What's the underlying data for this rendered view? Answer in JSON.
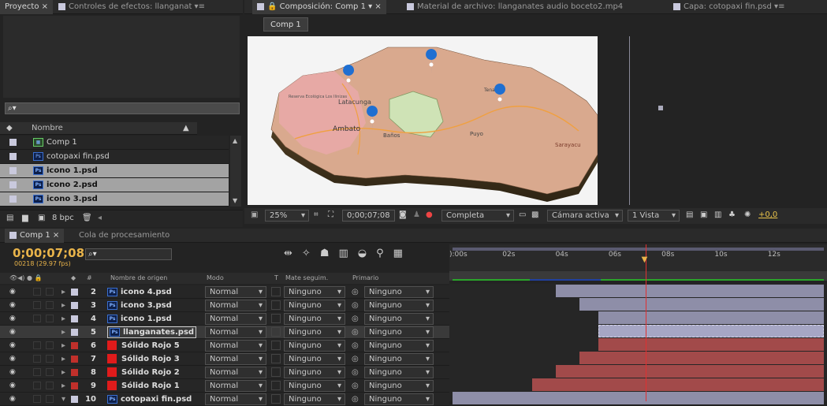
{
  "project_panel": {
    "tabs": [
      "Proyecto",
      "Controles de efectos: llanganat"
    ],
    "search_placeholder": "⌕▾",
    "column": "Nombre",
    "items": [
      {
        "name": "Comp 1",
        "type": "comp",
        "color": "#c9c9dd"
      },
      {
        "name": "cotopaxi fin.psd",
        "type": "psd",
        "color": "#c9c9dd"
      },
      {
        "name": "icono 1.psd",
        "type": "psd",
        "color": "#c9c9dd"
      },
      {
        "name": "icono 2.psd",
        "type": "psd",
        "color": "#c9c9dd"
      },
      {
        "name": "icono 3.psd",
        "type": "psd",
        "color": "#c9c9dd"
      }
    ],
    "bpc": "8 bpc"
  },
  "comp_panel": {
    "tabs": [
      "Composición: Comp 1",
      "Material de archivo: llanganates audio boceto2.mp4",
      "Capa: cotopaxi fin.psd"
    ],
    "subtab": "Comp 1",
    "viewer": {
      "zoom": "25%",
      "timecode": "0;00;07;08",
      "resolution": "Completa",
      "camera": "Cámara activa",
      "views": "1 Vista",
      "exposure": "+0,0"
    },
    "map_labels": [
      "Latacunga",
      "Ambato",
      "Baños",
      "Puyo",
      "Sarayacu",
      "Tena",
      "Reserva Ecológica Los Ilinizas"
    ]
  },
  "timeline": {
    "tabs": [
      "Comp 1",
      "Cola de procesamiento"
    ],
    "timecode": "0;00;07;08",
    "frames": "00218 (29.97 fps)",
    "headers": {
      "source": "Nombre de origen",
      "mode": "Modo",
      "t": "T",
      "matte": "Mate seguim.",
      "parent": "Primario"
    },
    "ruler": [
      "):00s",
      "02s",
      "04s",
      "06s",
      "08s",
      "10s",
      "12s"
    ],
    "layers": [
      {
        "num": "2",
        "name": "icono 4.psd",
        "kind": "psd",
        "label": "#c9c9dd",
        "mode": "Normal",
        "matte": "Ninguno",
        "parent": "Ninguno",
        "start": 3.9,
        "end": 14,
        "bar": "#8e8ea8"
      },
      {
        "num": "3",
        "name": "icono 3.psd",
        "kind": "psd",
        "label": "#c9c9dd",
        "mode": "Normal",
        "matte": "Ninguno",
        "parent": "Ninguno",
        "start": 4.8,
        "end": 14,
        "bar": "#8e8ea8"
      },
      {
        "num": "4",
        "name": "icono 1.psd",
        "kind": "psd",
        "label": "#c9c9dd",
        "mode": "Normal",
        "matte": "Ninguno",
        "parent": "Ninguno",
        "start": 5.5,
        "end": 14,
        "bar": "#8e8ea8"
      },
      {
        "num": "5",
        "name": "llanganates.psd",
        "kind": "psd",
        "label": "#c9c9dd",
        "mode": "Normal",
        "matte": "Ninguno",
        "parent": "Ninguno",
        "start": 5.5,
        "end": 14,
        "bar": "#a6a6c4",
        "selected": true
      },
      {
        "num": "6",
        "name": "Sólido Rojo 5",
        "kind": "solid",
        "label": "#c0302b",
        "mode": "Normal",
        "matte": "Ninguno",
        "parent": "Ninguno",
        "start": 5.5,
        "end": 14,
        "bar": "#a24a4a"
      },
      {
        "num": "7",
        "name": "Sólido Rojo 3",
        "kind": "solid",
        "label": "#c0302b",
        "mode": "Normal",
        "matte": "Ninguno",
        "parent": "Ninguno",
        "start": 4.8,
        "end": 14,
        "bar": "#a24a4a"
      },
      {
        "num": "8",
        "name": "Sólido Rojo 2",
        "kind": "solid",
        "label": "#c0302b",
        "mode": "Normal",
        "matte": "Ninguno",
        "parent": "Ninguno",
        "start": 3.9,
        "end": 14,
        "bar": "#a24a4a"
      },
      {
        "num": "9",
        "name": "Sólido Rojo 1",
        "kind": "solid",
        "label": "#c0302b",
        "mode": "Normal",
        "matte": "Ninguno",
        "parent": "Ninguno",
        "start": 3.0,
        "end": 14,
        "bar": "#a24a4a"
      },
      {
        "num": "10",
        "name": "cotopaxi fin.psd",
        "kind": "psd",
        "label": "#c9c9dd",
        "mode": "Normal",
        "matte": "Ninguno",
        "parent": "Ninguno",
        "start": 0,
        "end": 14,
        "bar": "#8e8ea8",
        "twirl": "open"
      }
    ],
    "current_time_s": 7.27
  }
}
